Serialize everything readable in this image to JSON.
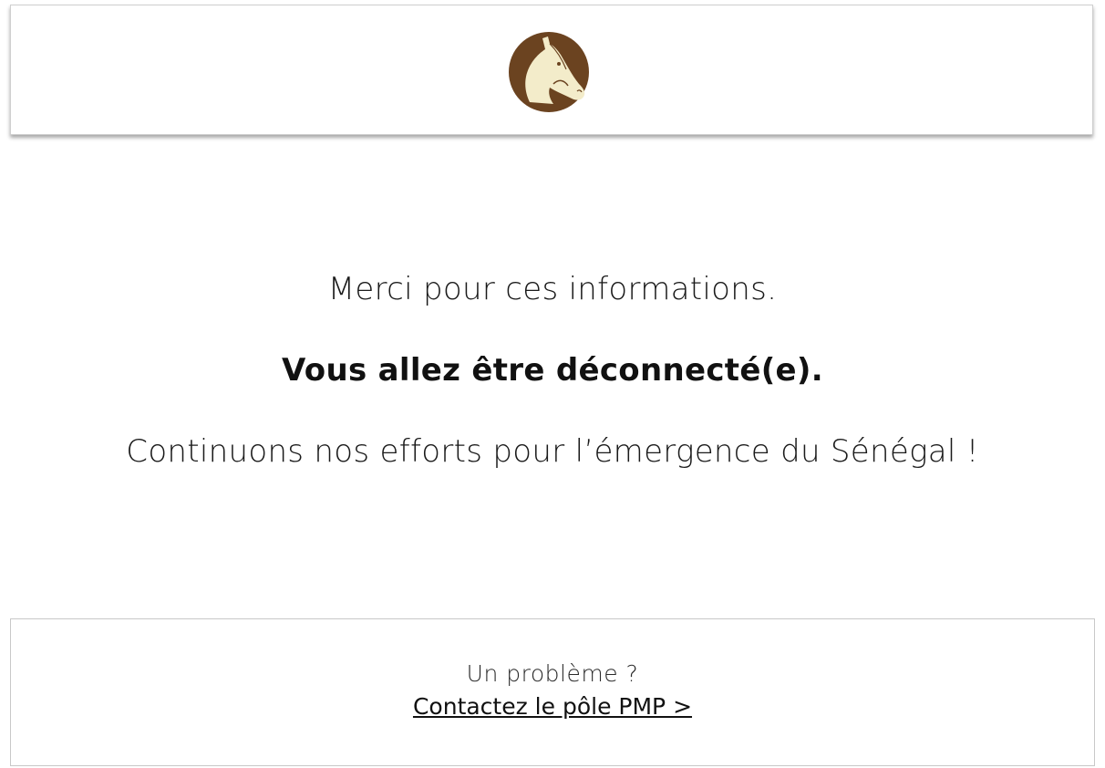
{
  "header": {
    "logo_icon": "horse-head-icon",
    "logo_colors": {
      "circle": "#6b4320",
      "horse": "#f3ecca"
    }
  },
  "message": {
    "line1": "Merci pour ces informations.",
    "line2": "Vous allez être déconnecté(e).",
    "line3": "Continuons nos efforts pour l’émergence du Sénégal !"
  },
  "footer": {
    "question": "Un problème ?",
    "link_label": "Contactez le pôle PMP >"
  }
}
